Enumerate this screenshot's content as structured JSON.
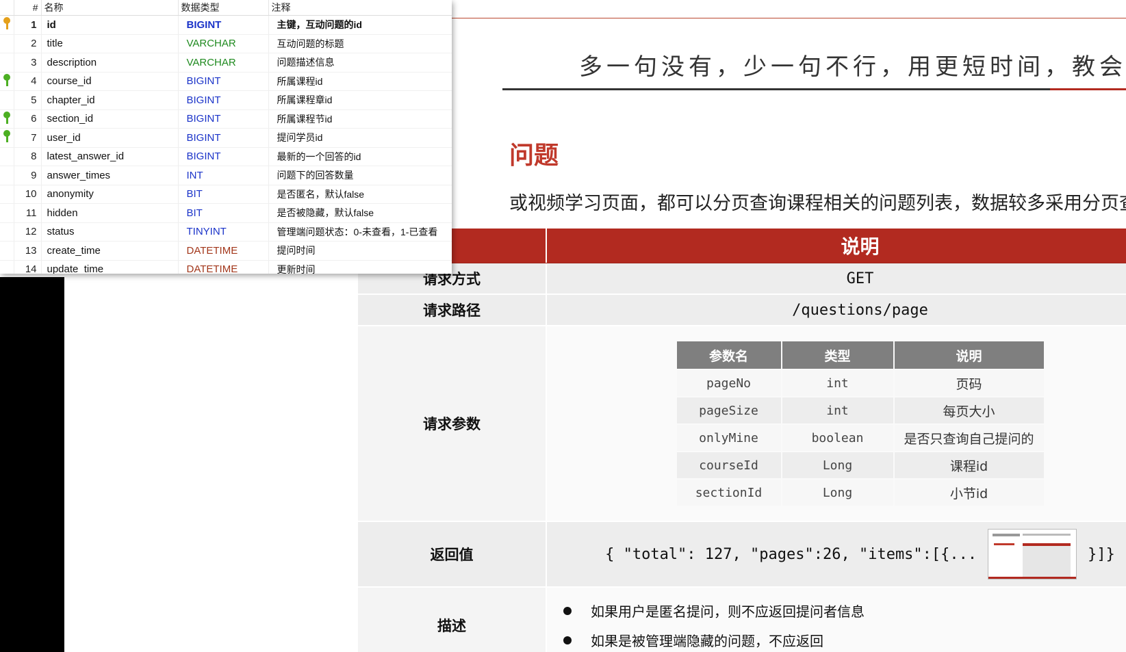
{
  "db_table": {
    "headers": [
      "#",
      "名称",
      "数据类型",
      "注释"
    ],
    "rows": [
      {
        "num": "1",
        "key": "primary",
        "name": "id",
        "type": "BIGINT",
        "type_color": "#1a33c9",
        "comment": "主键，互动问题的id"
      },
      {
        "num": "2",
        "key": "",
        "name": "title",
        "type": "VARCHAR",
        "type_color": "#1f8a1f",
        "comment": "互动问题的标题"
      },
      {
        "num": "3",
        "key": "",
        "name": "description",
        "type": "VARCHAR",
        "type_color": "#1f8a1f",
        "comment": "问题描述信息"
      },
      {
        "num": "4",
        "key": "index",
        "name": "course_id",
        "type": "BIGINT",
        "type_color": "#1a33c9",
        "comment": "所属课程id"
      },
      {
        "num": "5",
        "key": "",
        "name": "chapter_id",
        "type": "BIGINT",
        "type_color": "#1a33c9",
        "comment": "所属课程章id"
      },
      {
        "num": "6",
        "key": "index",
        "name": "section_id",
        "type": "BIGINT",
        "type_color": "#1a33c9",
        "comment": "所属课程节id"
      },
      {
        "num": "7",
        "key": "index",
        "name": "user_id",
        "type": "BIGINT",
        "type_color": "#1a33c9",
        "comment": "提问学员id"
      },
      {
        "num": "8",
        "key": "",
        "name": "latest_answer_id",
        "type": "BIGINT",
        "type_color": "#1a33c9",
        "comment": "最新的一个回答的id"
      },
      {
        "num": "9",
        "key": "",
        "name": "answer_times",
        "type": "INT",
        "type_color": "#1a33c9",
        "comment": "问题下的回答数量"
      },
      {
        "num": "10",
        "key": "",
        "name": "anonymity",
        "type": "BIT",
        "type_color": "#1a33c9",
        "comment": "是否匿名，默认false"
      },
      {
        "num": "11",
        "key": "",
        "name": "hidden",
        "type": "BIT",
        "type_color": "#1a33c9",
        "comment": "是否被隐藏，默认false"
      },
      {
        "num": "12",
        "key": "",
        "name": "status",
        "type": "TINYINT",
        "type_color": "#1a33c9",
        "comment": "管理端问题状态：0-未查看，1-已查看"
      },
      {
        "num": "13",
        "key": "",
        "name": "create_time",
        "type": "DATETIME",
        "type_color": "#a2361a",
        "comment": "提问时间"
      },
      {
        "num": "14",
        "key": "",
        "name": "update_time",
        "type": "DATETIME",
        "type_color": "#a2361a",
        "comment": "更新时间"
      }
    ]
  },
  "slide": {
    "slogan": "多一句没有，少一句不行，用更短时间，教会更实用的",
    "heading": "问题",
    "intro": "或视频学习页面，都可以分页查询课程相关的问题列表，数据较多采用分页查询",
    "table": {
      "header_right": "说明",
      "method_label": "请求方式",
      "method": "GET",
      "path_label": "请求路径",
      "path": "/questions/page",
      "params_label": "请求参数",
      "param_headers": [
        "参数名",
        "类型",
        "说明"
      ],
      "params": [
        {
          "name": "pageNo",
          "type": "int",
          "desc": "页码"
        },
        {
          "name": "pageSize",
          "type": "int",
          "desc": "每页大小"
        },
        {
          "name": "onlyMine",
          "type": "boolean",
          "desc": "是否只查询自己提问的"
        },
        {
          "name": "courseId",
          "type": "Long",
          "desc": "课程id"
        },
        {
          "name": "sectionId",
          "type": "Long",
          "desc": "小节id"
        }
      ],
      "return_label": "返回值",
      "return_value": "{ \"total\": 127, \"pages\":26, \"items\":[{...",
      "return_suffix": "}]}",
      "desc_label": "描述",
      "desc_items": [
        "如果用户是匿名提问，则不应返回提问者信息",
        "如果是被管理端隐藏的问题，不应返回"
      ]
    }
  },
  "colors": {
    "accent": "#b22a20",
    "param_header": "#7f7f7f"
  }
}
